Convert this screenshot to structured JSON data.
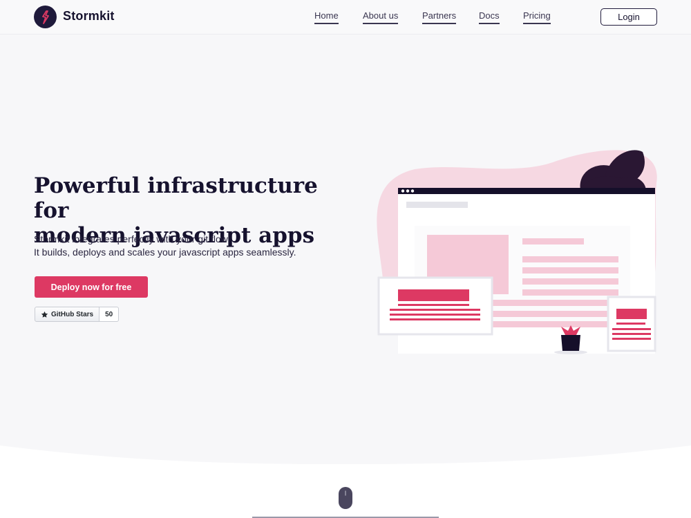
{
  "nav": {
    "brand": "Stormkit",
    "links": [
      "Home",
      "About us",
      "Partners",
      "Docs",
      "Pricing"
    ],
    "login": "Login"
  },
  "hero": {
    "title_line1": "Powerful infrastructure for",
    "title_line2": "modern javascript apps",
    "sub_line1": "Stormkit integrates perfectly with your git flow.",
    "sub_line2": "It builds, deploys and scales your javascript apps seamlessly.",
    "cta": "Deploy now for free",
    "github_label": "GitHub Stars",
    "github_count": "50"
  },
  "colors": {
    "accent": "#dd3963",
    "dark": "#1f1a3b",
    "pink_light": "#f5c9d7"
  }
}
